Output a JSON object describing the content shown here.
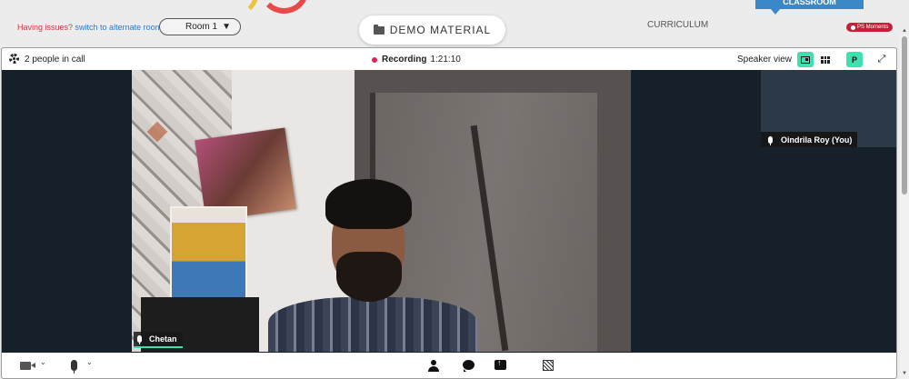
{
  "header": {
    "issues_text": "Having issues?",
    "alternate_room_link": "switch to alternate room",
    "room_select_value": "Room 1",
    "demo_material_label": "DEMO MATERIAL",
    "curriculum_label": "CURRICULUM",
    "classroom_label": "CLASSROOM",
    "ps_moments_label": "PS Moments"
  },
  "call": {
    "people_count_text": "2 people in call",
    "recording_label": "Recording",
    "recording_time": "1:21:10",
    "view_label": "Speaker view",
    "p_button_label": "P"
  },
  "participants": {
    "main_speaker_name": "Chetan",
    "side_participant_name": "Oindrila Roy (You)"
  },
  "icons": {
    "settings": "gear-icon",
    "recording": "record-dot-icon",
    "speaker_view": "speaker-view-icon",
    "grid_view": "grid-view-icon",
    "fullscreen": "fullscreen-icon",
    "camera": "camera-icon",
    "microphone": "microphone-icon",
    "participants": "person-icon",
    "chat": "chat-icon",
    "share": "share-screen-icon",
    "background": "background-icon",
    "folder": "folder-icon"
  },
  "colors": {
    "accent_teal": "#3fe0b0",
    "recording_red": "#e0245a",
    "classroom_blue": "#3b88c9",
    "ps_moments_red": "#c4203a",
    "link_blue": "#2b7bd0",
    "issue_red": "#d9333f"
  }
}
